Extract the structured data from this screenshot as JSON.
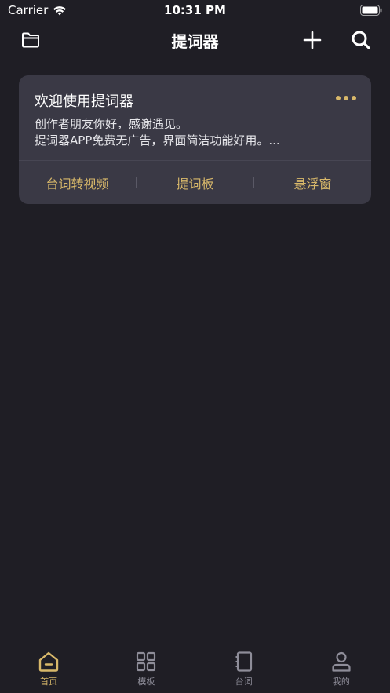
{
  "status_bar": {
    "carrier": "Carrier",
    "time": "10:31 PM"
  },
  "nav": {
    "title": "提词器",
    "icons": [
      "folder-icon",
      "plus-icon",
      "search-icon"
    ]
  },
  "card": {
    "title": "欢迎使用提词器",
    "desc_line1": "创作者朋友你好，感谢遇见。",
    "desc_line2": "提词器APP免费无广告，界面简洁功能好用。...",
    "actions": [
      "台词转视频",
      "提词板",
      "悬浮窗"
    ]
  },
  "tabs": [
    {
      "label": "首页",
      "icon": "home-icon",
      "active": true
    },
    {
      "label": "模板",
      "icon": "grid-icon",
      "active": false
    },
    {
      "label": "台词",
      "icon": "notebook-icon",
      "active": false
    },
    {
      "label": "我的",
      "icon": "person-icon",
      "active": false
    }
  ],
  "colors": {
    "background": "#1f1e25",
    "card": "#3a3945",
    "accent": "#d8b86a",
    "inactive": "#8e8d99"
  }
}
